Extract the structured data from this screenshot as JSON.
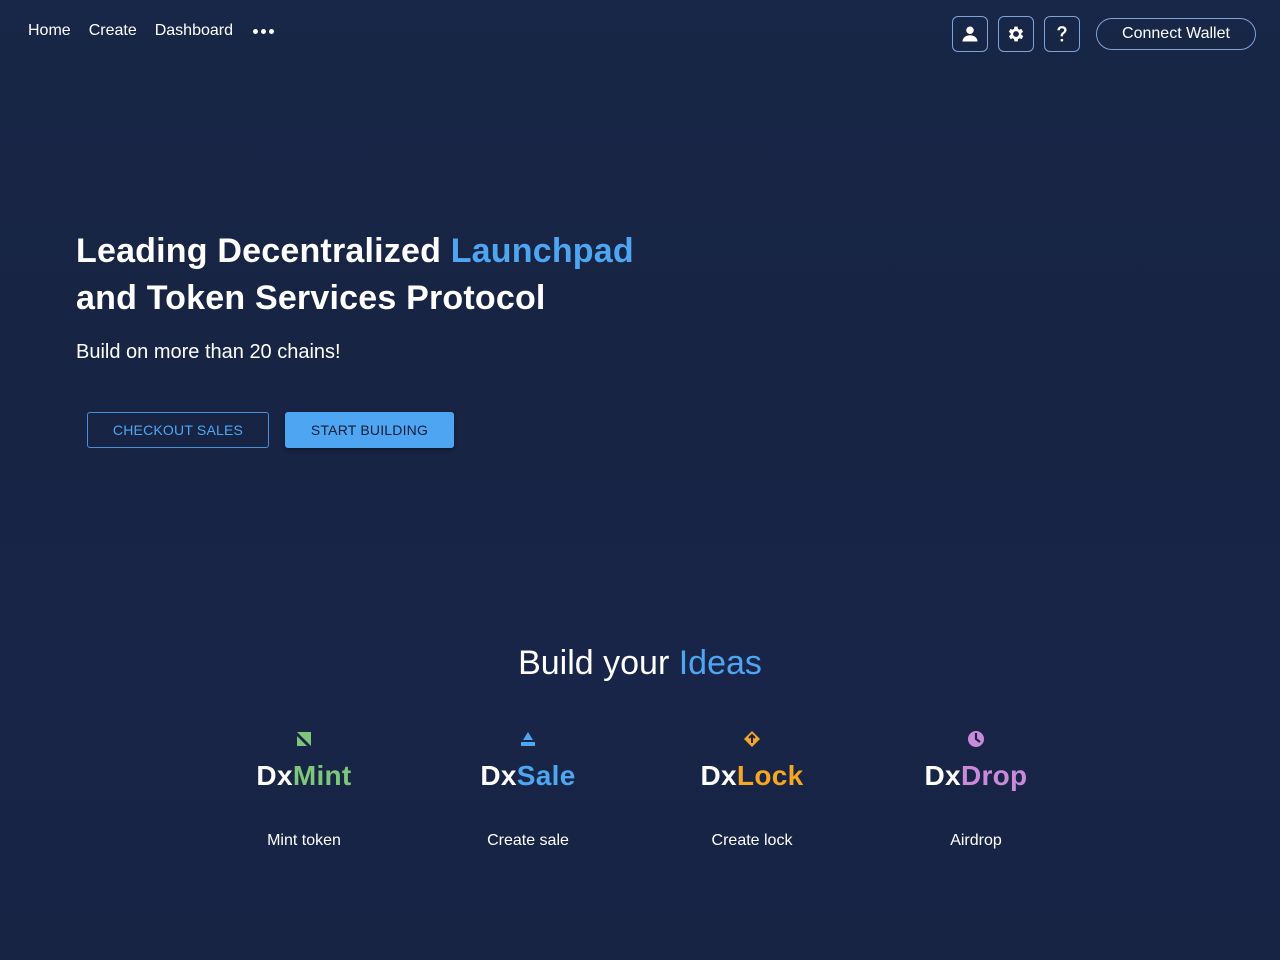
{
  "nav": {
    "links": [
      "Home",
      "Create",
      "Dashboard"
    ],
    "more_icon": "more-horizontal-icon",
    "icons": [
      "user-icon",
      "gear-icon",
      "help-icon"
    ],
    "wallet_label": "Connect Wallet"
  },
  "hero": {
    "title_part1": "Leading Decentralized ",
    "title_accent": "Launchpad",
    "title_part2": "and Token Services Protocol",
    "subtitle": "Build on more than 20 chains!",
    "checkout_label": "CHECKOUT SALES",
    "start_label": "START BUILDING"
  },
  "ideas": {
    "title_prefix": "Build your ",
    "title_accent": "Ideas",
    "products": [
      {
        "prefix": "Dx",
        "suffix": "Mint",
        "color": "#7ec77a",
        "icon": "mint-icon",
        "desc": "Mint token"
      },
      {
        "prefix": "Dx",
        "suffix": "Sale",
        "color": "#4ea6f2",
        "icon": "sale-icon",
        "desc": "Create sale"
      },
      {
        "prefix": "Dx",
        "suffix": "Lock",
        "color": "#f5a623",
        "icon": "lock-icon",
        "desc": "Create lock"
      },
      {
        "prefix": "Dx",
        "suffix": "Drop",
        "color": "#c98bd9",
        "icon": "drop-icon",
        "desc": "Airdrop"
      }
    ]
  },
  "colors": {
    "background": "#172443",
    "accent": "#4ea6f2",
    "border": "#7ea3d6"
  }
}
